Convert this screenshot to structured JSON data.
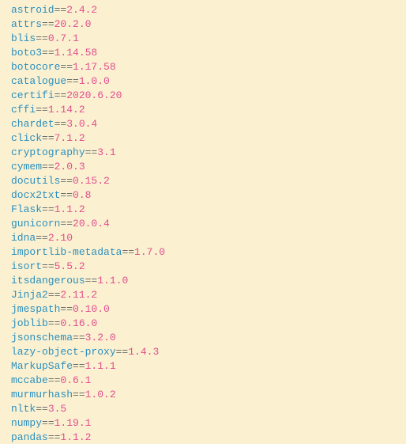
{
  "requirements": [
    {
      "pkg": "astroid",
      "op": "==",
      "ver": "2.4.2"
    },
    {
      "pkg": "attrs",
      "op": "==",
      "ver": "20.2.0"
    },
    {
      "pkg": "blis",
      "op": "==",
      "ver": "0.7.1"
    },
    {
      "pkg": "boto3",
      "op": "==",
      "ver": "1.14.58"
    },
    {
      "pkg": "botocore",
      "op": "==",
      "ver": "1.17.58"
    },
    {
      "pkg": "catalogue",
      "op": "==",
      "ver": "1.0.0"
    },
    {
      "pkg": "certifi",
      "op": "==",
      "ver": "2020.6.20"
    },
    {
      "pkg": "cffi",
      "op": "==",
      "ver": "1.14.2"
    },
    {
      "pkg": "chardet",
      "op": "==",
      "ver": "3.0.4"
    },
    {
      "pkg": "click",
      "op": "==",
      "ver": "7.1.2"
    },
    {
      "pkg": "cryptography",
      "op": "==",
      "ver": "3.1"
    },
    {
      "pkg": "cymem",
      "op": "==",
      "ver": "2.0.3"
    },
    {
      "pkg": "docutils",
      "op": "==",
      "ver": "0.15.2"
    },
    {
      "pkg": "docx2txt",
      "op": "==",
      "ver": "0.8"
    },
    {
      "pkg": "Flask",
      "op": "==",
      "ver": "1.1.2"
    },
    {
      "pkg": "gunicorn",
      "op": "==",
      "ver": "20.0.4"
    },
    {
      "pkg": "idna",
      "op": "==",
      "ver": "2.10"
    },
    {
      "pkg": "importlib-metadata",
      "op": "==",
      "ver": "1.7.0"
    },
    {
      "pkg": "isort",
      "op": "==",
      "ver": "5.5.2"
    },
    {
      "pkg": "itsdangerous",
      "op": "==",
      "ver": "1.1.0"
    },
    {
      "pkg": "Jinja2",
      "op": "==",
      "ver": "2.11.2"
    },
    {
      "pkg": "jmespath",
      "op": "==",
      "ver": "0.10.0"
    },
    {
      "pkg": "joblib",
      "op": "==",
      "ver": "0.16.0"
    },
    {
      "pkg": "jsonschema",
      "op": "==",
      "ver": "3.2.0"
    },
    {
      "pkg": "lazy-object-proxy",
      "op": "==",
      "ver": "1.4.3"
    },
    {
      "pkg": "MarkupSafe",
      "op": "==",
      "ver": "1.1.1"
    },
    {
      "pkg": "mccabe",
      "op": "==",
      "ver": "0.6.1"
    },
    {
      "pkg": "murmurhash",
      "op": "==",
      "ver": "1.0.2"
    },
    {
      "pkg": "nltk",
      "op": "==",
      "ver": "3.5"
    },
    {
      "pkg": "numpy",
      "op": "==",
      "ver": "1.19.1"
    },
    {
      "pkg": "pandas",
      "op": "==",
      "ver": "1.1.2"
    }
  ]
}
